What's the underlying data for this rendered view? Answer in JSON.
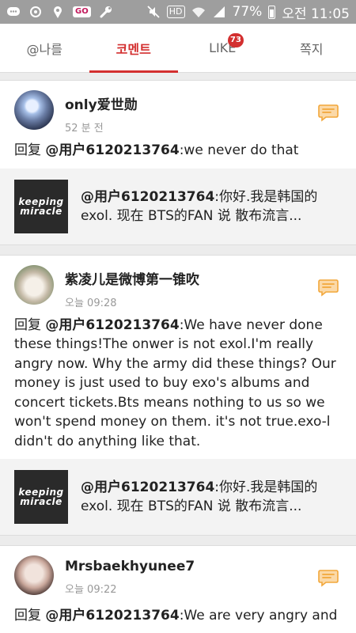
{
  "status_bar": {
    "go_label": "GO",
    "hd_label": "HD",
    "battery_pct": "77%",
    "time": "오전 11:05"
  },
  "tabs": [
    {
      "label": "@나를"
    },
    {
      "label": "코멘트"
    },
    {
      "label": "LIKE",
      "badge": "73"
    },
    {
      "label": "쪽지"
    }
  ],
  "active_tab": "코멘트",
  "accent_color": "#d32f2f",
  "items": [
    {
      "name": "only爱世勋",
      "time": "52 분 전",
      "reply_prefix": "回复 ",
      "mention": "@用户6120213764",
      "text": ":we never do that",
      "quote": {
        "thumb_line1": "keeping",
        "thumb_line2": "miracle",
        "mention": "@用户6120213764",
        "text": ":你好.我是韩国的exol. 现在 BTS的FAN 说 散布流言..."
      }
    },
    {
      "name": "紫凌儿是微博第一锥吹",
      "time": "오늘 09:28",
      "reply_prefix": "回复 ",
      "mention": "@用户6120213764",
      "text": ":We have never done these things!The onwer is not exol.I'm really angry now. Why the army did these things? Our money is just used to buy exo's albums and concert tickets.Bts means nothing to us so we won't spend money on them. it's not true.exo-l didn't do anything like that.",
      "quote": {
        "thumb_line1": "keeping",
        "thumb_line2": "miracle",
        "mention": "@用户6120213764",
        "text": ":你好.我是韩国的exol. 现在 BTS的FAN 说 散布流言..."
      }
    },
    {
      "name": "Mrsbaekhyunee7",
      "time": "오늘 09:22",
      "reply_prefix": "回复 ",
      "mention": "@用户6120213764",
      "text": ":We are very angry and"
    }
  ],
  "icons": {
    "reply": "comment-bubble-icon",
    "status_left": [
      "chat-icon",
      "sync-icon",
      "location-icon",
      "go-app-icon",
      "wrench-icon"
    ],
    "status_right": [
      "mute-icon",
      "hd-icon",
      "wifi-icon",
      "signal-icon",
      "battery-icon"
    ]
  }
}
